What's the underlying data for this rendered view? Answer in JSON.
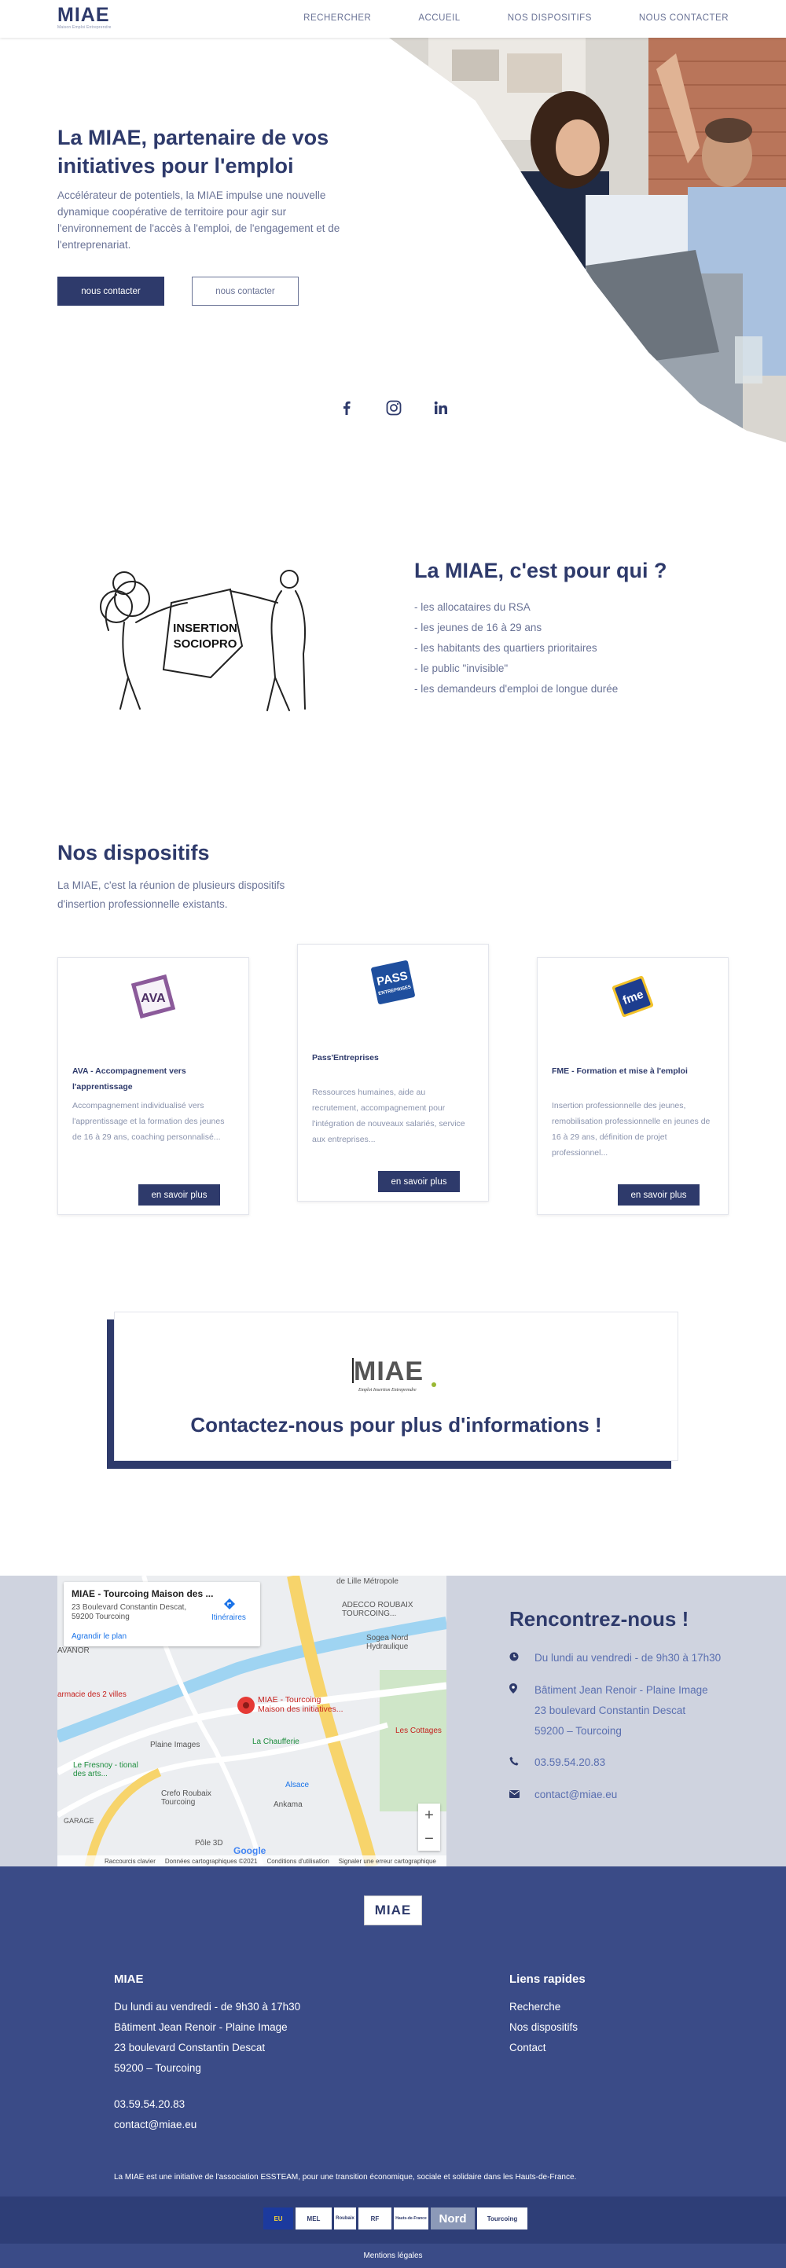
{
  "header": {
    "logo": "MIAE",
    "logo_tagline": "Maison Emploi Entreprendre",
    "nav": [
      "RECHERCHER",
      "ACCUEIL",
      "NOS DISPOSITIFS",
      "NOUS CONTACTER"
    ]
  },
  "hero": {
    "title": "La MIAE, partenaire de vos initiatives pour l'emploi",
    "description": "Accélérateur de potentiels, la MIAE impulse une nouvelle dynamique coopérative de territoire pour agir sur l'environnement de l'accès à l'emploi, de l'engagement et de l'entreprenariat.",
    "btn_primary": "nous contacter",
    "btn_secondary": "nous contacter"
  },
  "social": [
    "facebook-icon",
    "instagram-icon",
    "linkedin-icon"
  ],
  "pour_qui": {
    "illustration_label_1": "INSERTION",
    "illustration_label_2": "SOCIOPRO",
    "title": "La MIAE, c'est pour qui ?",
    "items": [
      "- les allocataires du RSA",
      "- les jeunes de 16 à 29 ans",
      "- les habitants des quartiers prioritaires",
      "- le public \"invisible\"",
      "- les demandeurs d'emploi de longue durée"
    ]
  },
  "dispositifs": {
    "title": "Nos dispositifs",
    "description": "La MIAE, c'est la réunion de plusieurs dispositifs d'insertion professionnelle existants.",
    "cards": [
      {
        "logo": "AVA",
        "title": "AVA - Accompagnement vers l'apprentissage",
        "text": "Accompagnement individualisé vers l'apprentissage et la formation des jeunes de 16 à 29 ans, coaching personnalisé...",
        "button": "en savoir plus"
      },
      {
        "logo": "PASS",
        "logo_sub": "ENTREPRISES",
        "title": "Pass'Entreprises",
        "text": "Ressources humaines, aide au recrutement, accompagnement pour l'intégration de nouveaux salariés, service aux entreprises...",
        "button": "en savoir plus"
      },
      {
        "logo": "fme",
        "title": "FME - Formation et mise à l'emploi",
        "text": "Insertion professionnelle des jeunes, remobilisation professionnelle en jeunes de 16 à 29 ans, définition de projet professionnel...",
        "button": "en savoir plus"
      }
    ]
  },
  "contact_box": {
    "logo": "MIAE",
    "logo_tagline": "Emploi Insertion Entreprendre",
    "title": "Contactez-nous pour plus d'informations !"
  },
  "map": {
    "place_name": "MIAE - Tourcoing Maison des ...",
    "place_addr_1": "23 Boulevard Constantin Descat,",
    "place_addr_2": "59200 Tourcoing",
    "enlarge": "Agrandir le plan",
    "directions": "Itinéraires",
    "pin_label_1": "MIAE - Tourcoing",
    "pin_label_2": "Maison des initiatives...",
    "labels": [
      "de Lille Métropole",
      "ADECCO ROUBAIX TOURCOING...",
      "Sogea Nord Hydraulique",
      "AVANOR",
      "armacie des 2 villes",
      "Plaine Images",
      "La Chaufferie",
      "Les Cottages",
      "Le Fresnoy - tional des arts...",
      "Crefo Roubaix Tourcoing",
      "Ankama",
      "Alsace",
      "Pôle 3D",
      "GARAGE"
    ],
    "footer": [
      "Raccourcis clavier",
      "Données cartographiques ©2021",
      "Conditions d'utilisation",
      "Signaler une erreur cartographique"
    ],
    "google": "Google"
  },
  "rencontrez": {
    "title": "Rencontrez-nous !",
    "hours": "Du lundi au vendredi - de 9h30 à 17h30",
    "address": [
      "Bâtiment Jean Renoir - Plaine Image",
      "23 boulevard Constantin Descat",
      "59200 – Tourcoing"
    ],
    "phone": "03.59.54.20.83",
    "email": "contact@miae.eu"
  },
  "footer": {
    "logo": "MIAE",
    "col1_title": "MIAE",
    "col1_lines": [
      "Du lundi au vendredi - de 9h30 à 17h30",
      "Bâtiment Jean Renoir - Plaine Image",
      "23 boulevard Constantin Descat",
      "59200 – Tourcoing"
    ],
    "phone": "03.59.54.20.83",
    "email": "contact@miae.eu",
    "col2_title": "Liens rapides",
    "links": [
      "Recherche",
      "Nos dispositifs",
      "Contact"
    ],
    "note": "La MIAE est une initiative de l'association ESSTEAM, pour une transition économique, sociale et solidaire dans les Hauts-de-France.",
    "partners": [
      "EU",
      "MEL",
      "Roubaix",
      "RF",
      "Hauts-de-France",
      "Nord",
      "Tourcoing"
    ],
    "legal": "Mentions légales"
  },
  "colors": {
    "primary": "#2e3a6b",
    "footer": "#3a4b87",
    "text_muted": "#6a7396",
    "map_band": "#cfd3df"
  }
}
